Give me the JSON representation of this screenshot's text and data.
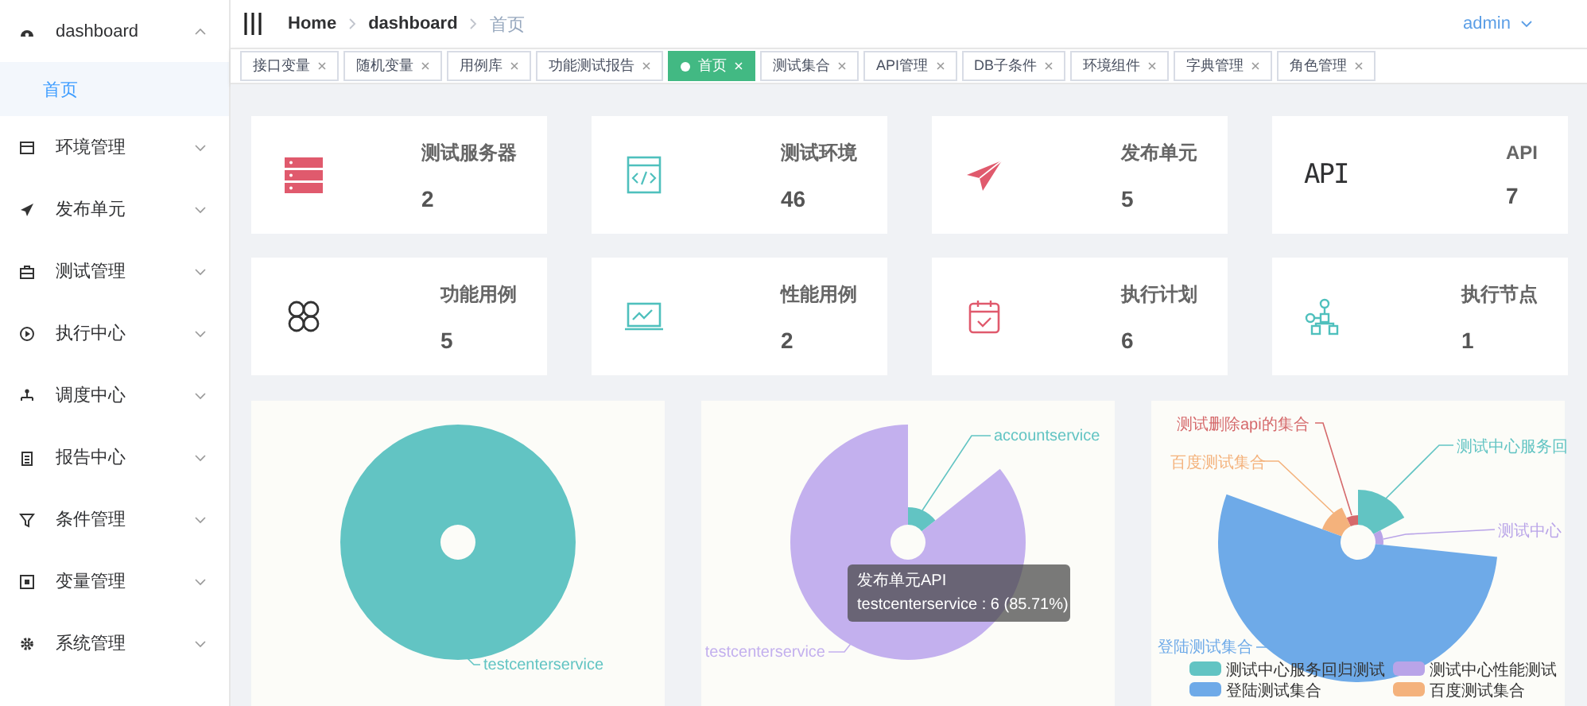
{
  "sidebar": {
    "items": [
      {
        "label": "dashboard",
        "expanded": true,
        "children": [
          {
            "label": "首页",
            "selected": true
          }
        ]
      },
      {
        "label": "环境管理",
        "expanded": false
      },
      {
        "label": "发布单元",
        "expanded": false
      },
      {
        "label": "测试管理",
        "expanded": false
      },
      {
        "label": "执行中心",
        "expanded": false
      },
      {
        "label": "调度中心",
        "expanded": false
      },
      {
        "label": "报告中心",
        "expanded": false
      },
      {
        "label": "条件管理",
        "expanded": false
      },
      {
        "label": "变量管理",
        "expanded": false
      },
      {
        "label": "系统管理",
        "expanded": false
      }
    ]
  },
  "header": {
    "breadcrumb": [
      {
        "label": "Home",
        "current": false
      },
      {
        "label": "dashboard",
        "current": false
      },
      {
        "label": "首页",
        "current": true
      }
    ],
    "user": "admin"
  },
  "tabs": [
    {
      "label": "接口变量",
      "selected": false
    },
    {
      "label": "随机变量",
      "selected": false
    },
    {
      "label": "用例库",
      "selected": false
    },
    {
      "label": "功能测试报告",
      "selected": false
    },
    {
      "label": "首页",
      "selected": true
    },
    {
      "label": "测试集合",
      "selected": false
    },
    {
      "label": "API管理",
      "selected": false
    },
    {
      "label": "DB子条件",
      "selected": false
    },
    {
      "label": "环境组件",
      "selected": false
    },
    {
      "label": "字典管理",
      "selected": false
    },
    {
      "label": "角色管理",
      "selected": false
    }
  ],
  "stats": [
    {
      "title": "测试服务器",
      "value": "2"
    },
    {
      "title": "测试环境",
      "value": "46"
    },
    {
      "title": "发布单元",
      "value": "5"
    },
    {
      "title": "API",
      "value": "7",
      "icon_text": "API"
    },
    {
      "title": "功能用例",
      "value": "5"
    },
    {
      "title": "性能用例",
      "value": "2"
    },
    {
      "title": "执行计划",
      "value": "6"
    },
    {
      "title": "执行节点",
      "value": "1"
    }
  ],
  "charts": [
    {
      "slices": [
        {
          "label": "testcenterservice",
          "color": "#62c4c3"
        }
      ]
    },
    {
      "slices": [
        {
          "label": "testcenterservice",
          "color": "#c3b0ee"
        },
        {
          "label": "accountservice",
          "color": "#62c4c3"
        }
      ],
      "tooltip": {
        "title": "发布单元API",
        "text": "testcenterservice : 6 (85.71%)"
      }
    },
    {
      "slices": [
        {
          "label": "测试删除api的集合",
          "color": "#d5696b"
        },
        {
          "label": "测试中心服务回",
          "color": "#62c4c3"
        },
        {
          "label": "百度测试集合",
          "color": "#f4b27c"
        },
        {
          "label": "测试中心",
          "color": "#b9a4e8"
        },
        {
          "label": "登陆测试集合",
          "color": "#6eaae8"
        }
      ],
      "legend": [
        {
          "label": "测试中心服务回归测试",
          "color": "#62c4c3"
        },
        {
          "label": "测试中心性能测试",
          "color": "#b9a4e8"
        },
        {
          "label": "登陆测试集合",
          "color": "#6eaae8"
        },
        {
          "label": "百度测试集合",
          "color": "#f4b27c"
        }
      ]
    }
  ]
}
